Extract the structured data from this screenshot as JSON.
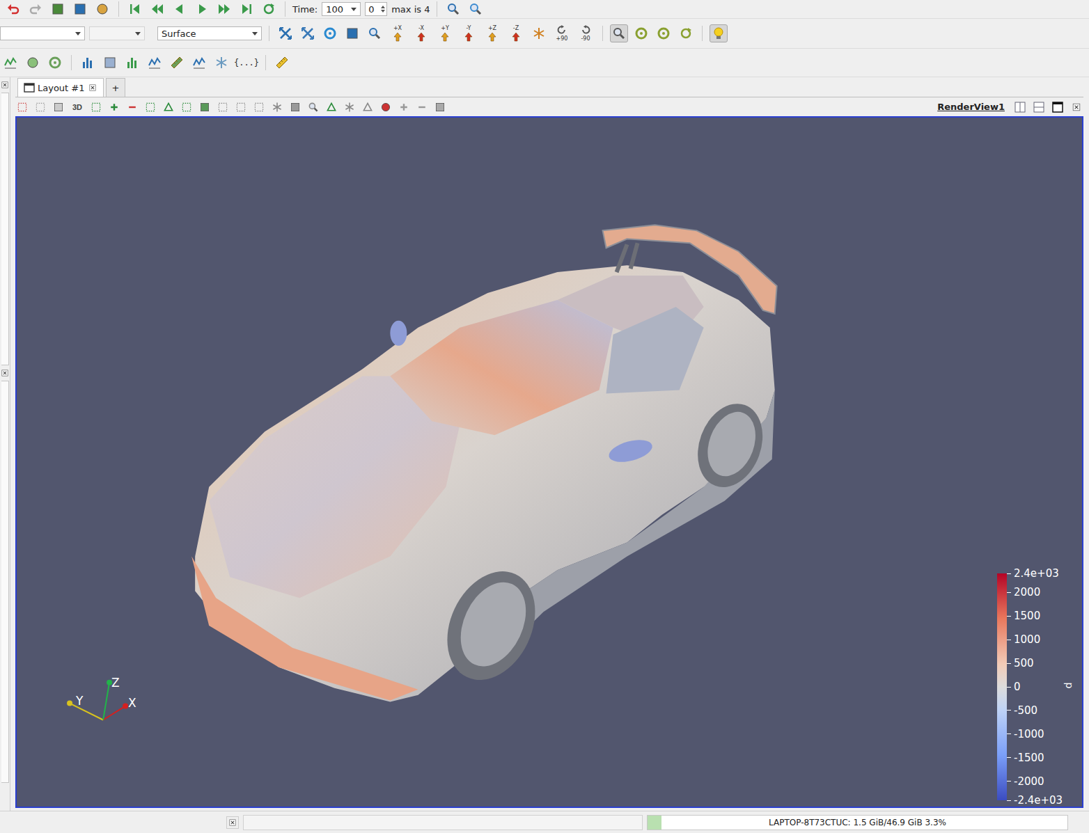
{
  "toolbar": {
    "time_label": "Time:",
    "time_value": "100",
    "timestep": "0",
    "max_label": "max is 4"
  },
  "pipeline_combos": [
    {
      "value": "",
      "disabled": false
    },
    {
      "value": "",
      "disabled": true
    }
  ],
  "representation": "Surface",
  "camera_buttons": [
    "+X",
    "-X",
    "+Y",
    "-Y",
    "+Z",
    "-Z"
  ],
  "rotate_buttons": [
    "+90",
    "-90"
  ],
  "view_toggles": [
    {
      "pressed": true
    },
    {
      "pressed": false
    },
    {
      "pressed": false
    },
    {
      "pressed": false
    }
  ],
  "light_kit": {
    "pressed": true
  },
  "filters_toolbar": {
    "glyph_button": "{...}"
  },
  "tabs": [
    {
      "label": "Layout #1",
      "selected": true,
      "closable": true
    },
    {
      "label": "+",
      "selected": false,
      "closable": false
    }
  ],
  "view_toolbar": {
    "mode_label": "3D",
    "view_name": "RenderView1"
  },
  "legend": {
    "title": "p",
    "ticks": [
      "2.4e+03",
      "2000",
      "1500",
      "1000",
      "500",
      "0",
      "-500",
      "-1000",
      "-1500",
      "-2000",
      "-2.4e+03"
    ]
  },
  "triad": [
    {
      "label": "X",
      "color": "#d42020"
    },
    {
      "label": "Y",
      "color": "#d8c21e"
    },
    {
      "label": "Z",
      "color": "#22b44a"
    }
  ],
  "status_bar": {
    "memory": "LAPTOP-8T73CTUC: 1.5 GiB/46.9 GiB 3.3%",
    "memory_level": 0.033
  }
}
